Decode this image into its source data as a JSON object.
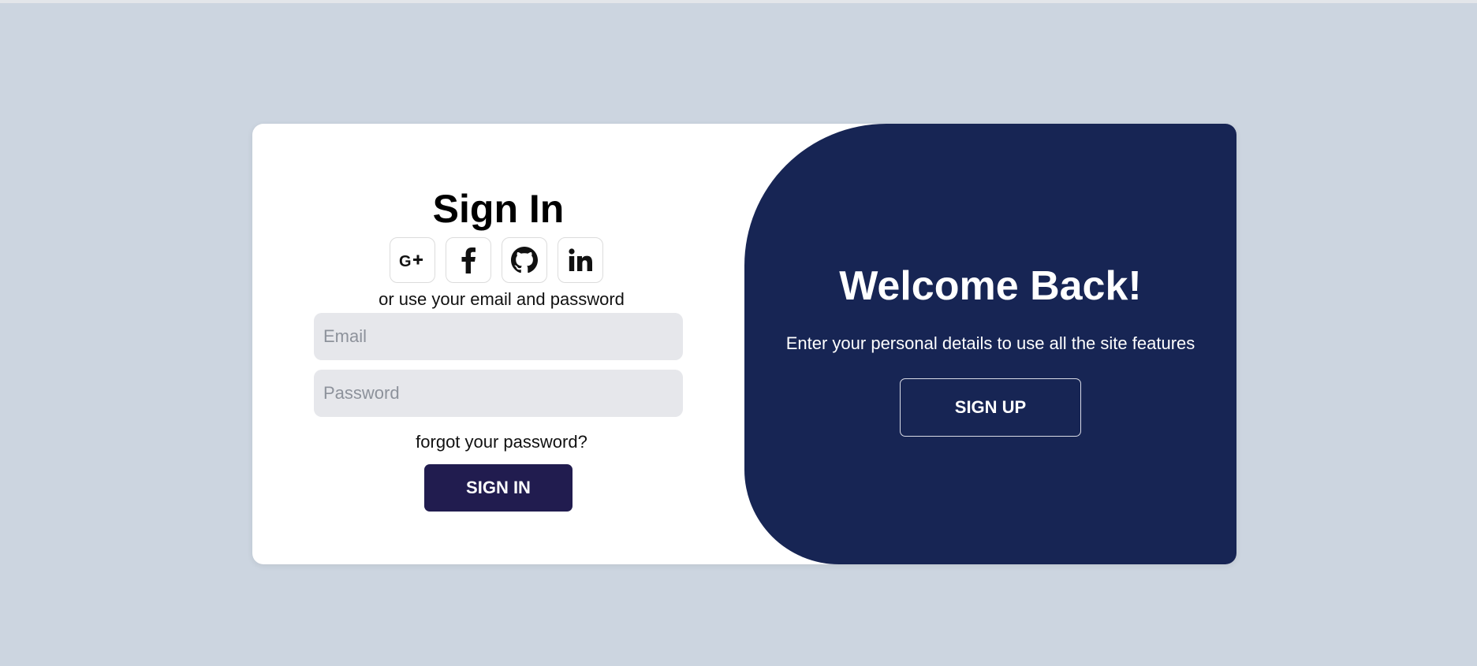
{
  "colors": {
    "page_background": "#ccd5e0",
    "card_background": "#ffffff",
    "accent_panel": "#172554",
    "signin_button": "#211c4f",
    "input_background": "#e6e7eb"
  },
  "signin": {
    "title": "Sign In",
    "social_icons": [
      "google-plus-icon",
      "facebook-icon",
      "github-icon",
      "linkedin-icon"
    ],
    "alt_text": "or use your email and password",
    "email_placeholder": "Email",
    "password_placeholder": "Password",
    "forgot_label": "forgot your password?",
    "button_label": "SIGN IN"
  },
  "welcome": {
    "title": "Welcome Back!",
    "text": "Enter your personal details to use all the site features",
    "button_label": "SIGN UP"
  }
}
